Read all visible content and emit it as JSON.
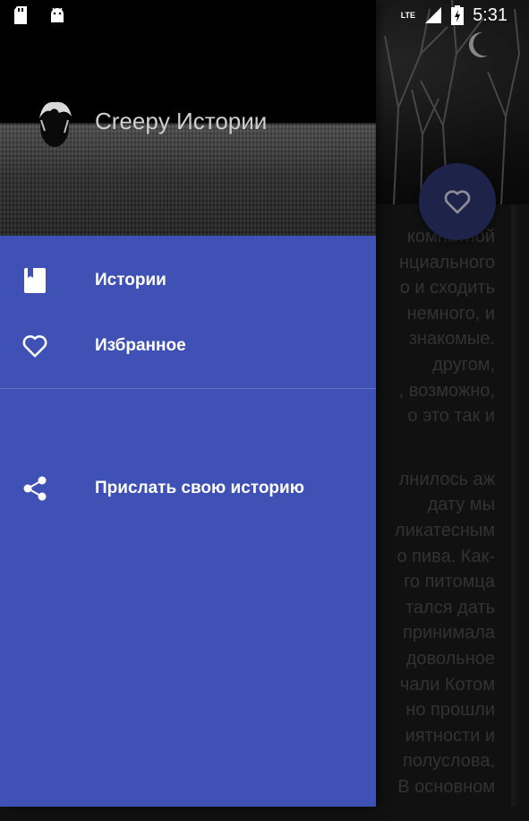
{
  "status_bar": {
    "time": "5:31",
    "network": "LTE",
    "icons": [
      "sd-card-icon",
      "android-icon",
      "signal-icon",
      "battery-charging-icon"
    ]
  },
  "drawer": {
    "app_name": "Creepy Истории",
    "items": [
      {
        "label": "Истории",
        "icon": "book-icon"
      },
      {
        "label": "Избранное",
        "icon": "heart-outline-icon"
      },
      {
        "label": "Прислать свою историю",
        "icon": "share-icon"
      }
    ],
    "accent": "#3f51b5"
  },
  "story": {
    "fragments": [
      "комнатной",
      "нциального",
      "о и сходить",
      "немного, и",
      "знакомые.",
      "другом,",
      ", возможно,",
      "о это так и"
    ],
    "fragments2": [
      "лнилось аж",
      "дату мы",
      "ликатесным",
      "о пива. Как-",
      "го питомца",
      "тался дать",
      "принимала",
      "довольное",
      "чали Котом",
      "но прошли",
      "иятности и",
      "полуслова,",
      "В основном"
    ]
  },
  "fab": {
    "icon": "heart-outline-icon"
  }
}
